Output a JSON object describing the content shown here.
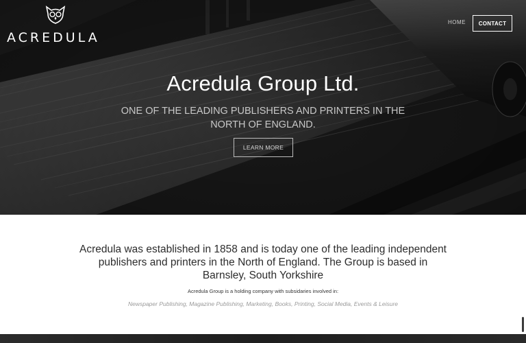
{
  "brand": {
    "logo_text": "ACREDULA",
    "logo_icon": "owl-icon"
  },
  "nav": {
    "home": "HOME",
    "contact": "CONTACT"
  },
  "hero": {
    "title": "Acredula Group Ltd.",
    "subtitle": "ONE OF THE LEADING PUBLISHERS AND PRINTERS IN THE NORTH OF ENGLAND.",
    "cta": "LEARN MORE"
  },
  "intro": {
    "lead": "Acredula was established in 1858 and is today one of the leading independent publishers and printers in the North of England. The Group is based in Barnsley, South Yorkshire",
    "holding": "Acredula Group is a holding company with subsidaries involved in:",
    "subsidiaries": "Newspaper Publishing, Magazine Publishing, Marketing, Books, Printing, Social Media, Events & Leisure"
  },
  "colors": {
    "hero_bg": "#262626",
    "text_dark": "#2c2c2c",
    "text_muted": "#9a9a9a",
    "white": "#ffffff"
  }
}
